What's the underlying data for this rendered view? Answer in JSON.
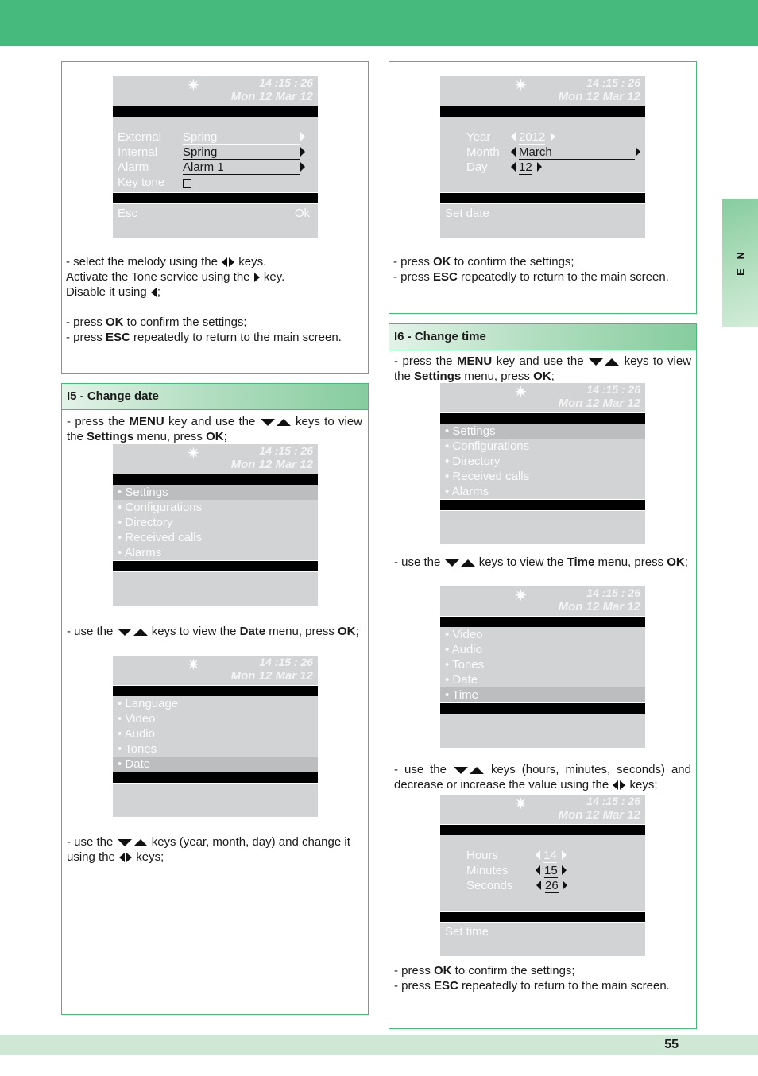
{
  "side_tab": {
    "label": "E N"
  },
  "page_number": "55",
  "screen_common": {
    "star_icon": "✷",
    "time": "14 :15 : 26",
    "date": "Mon 12 Mar 12"
  },
  "panel_tones": {
    "screen": {
      "rows": [
        {
          "label": "External",
          "value": "Spring"
        },
        {
          "label": "Internal",
          "value": "Spring"
        },
        {
          "label": "Alarm",
          "value": "Alarm 1"
        },
        {
          "label": "Key tone",
          "value": ""
        }
      ],
      "esc": "Esc",
      "ok": "Ok"
    },
    "text": {
      "l1a": "- select the melody using the",
      "l1b": "keys.",
      "l2a": "Activate the Tone service using the",
      "l2b": "key.",
      "l3a": "Disable it using",
      "l3b": ";",
      "p1a": "- press ",
      "p1b": "OK",
      "p1c": " to confirm the settings;",
      "p2a": "- press ",
      "p2b": "ESC",
      "p2c": " repeatedly to return to the main screen."
    }
  },
  "panel_setdate": {
    "screen": {
      "rows": [
        {
          "label": "Year",
          "value": "2012"
        },
        {
          "label": "Month",
          "value": "March"
        },
        {
          "label": "Day",
          "value": "12"
        }
      ],
      "footer": "Set date"
    },
    "text": {
      "p1a": "- press ",
      "p1b": "OK",
      "p1c": " to confirm the settings;",
      "p2a": "- press ",
      "p2b": "ESC",
      "p2c": " repeatedly to return to the main screen."
    }
  },
  "panel_i5": {
    "title": "I5 - Change date",
    "step1": {
      "a": "- press the ",
      "b": "MENU",
      "c": " key and use the",
      "d": "keys to view the ",
      "e": "Settings",
      "f": " menu, press ",
      "g": "OK",
      "h": ";"
    },
    "menu1": [
      "• Settings",
      "• Configurations",
      "• Directory",
      "• Received calls",
      "• Alarms"
    ],
    "step2": {
      "a": "- use the",
      "b": "keys to view the ",
      "c": "Date",
      "d": " menu, press ",
      "e": "OK",
      "f": ";"
    },
    "menu2": [
      "• Language",
      "• Video",
      "• Audio",
      "• Tones",
      "• Date"
    ],
    "step3": {
      "a": "- use the",
      "b": "keys (year, month, day) and change it using the",
      "c": "keys;"
    }
  },
  "panel_i6": {
    "title": "I6 - Change time",
    "step1": {
      "a": "- press the ",
      "b": "MENU",
      "c": " key and use the",
      "d": "keys to view the ",
      "e": "Settings",
      "f": " menu, press ",
      "g": "OK",
      "h": ";"
    },
    "menu1": [
      "• Settings",
      "• Configurations",
      "• Directory",
      "• Received calls",
      "• Alarms"
    ],
    "step2": {
      "a": "- use the",
      "b": "keys to view the ",
      "c": "Time",
      "d": " menu, press ",
      "e": "OK",
      "f": ";"
    },
    "menu2": [
      "• Video",
      "• Audio",
      "• Tones",
      "• Date",
      "• Time"
    ],
    "step3": {
      "a": "- use the",
      "b": "keys (hours, minutes, seconds) and decrease or increase the value using the",
      "c": "keys;"
    },
    "time_screen": {
      "rows": [
        {
          "label": "Hours",
          "value": "14"
        },
        {
          "label": "Minutes",
          "value": "15"
        },
        {
          "label": "Seconds",
          "value": "26"
        }
      ],
      "footer": "Set time"
    },
    "final": {
      "p1a": "- press ",
      "p1b": "OK",
      "p1c": " to confirm the settings;",
      "p2a": "- press ",
      "p2b": "ESC",
      "p2c": " repeatedly to return to the main screen."
    }
  },
  "colors": {
    "brand_green": "#46ba7d",
    "footer_band": "#cfe8d6",
    "screen_gray": "#d2d3d5",
    "selected_gray": "#bcbdbf"
  }
}
